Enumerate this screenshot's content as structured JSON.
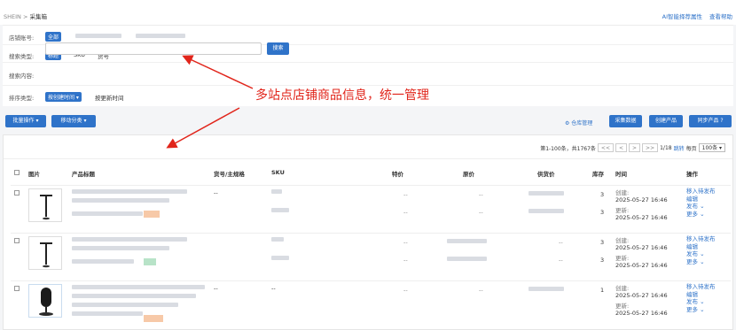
{
  "breadcrumb": {
    "root": "SHEIN",
    "sep": " > ",
    "current": "采集箱"
  },
  "top_links": {
    "ai": "AI智能择荐属性",
    "help": "查看帮助"
  },
  "filters": {
    "store_label": "店铺账号:",
    "store_all": "全部",
    "search_type_label": "搜索类型:",
    "search_types": [
      "标题",
      "SKU",
      "货号"
    ],
    "search_content_label": "搜索内容:",
    "search_button": "搜索",
    "sort_label": "排序类型:",
    "sort_selected": "按创建时间 ▾",
    "sort_alt": "按更新时间"
  },
  "toolbar": {
    "batch": "批量操作 ▾",
    "move": "移动分类 ▾",
    "warehouse": "⚙ 仓库管理",
    "collect": "采集数据",
    "create": "创建产品",
    "sync": "同步产品 ?"
  },
  "pager": {
    "summary": "第1-100条，共1767条",
    "first": "<<",
    "prev": "<",
    "next": ">",
    "last": ">>",
    "page": "1/18",
    "jump": "跳转",
    "per_page_label": "每页",
    "per_page": "100条 ▾"
  },
  "columns": [
    "图片",
    "产品标题",
    "货号/主规格",
    "SKU",
    "特价",
    "原价",
    "供货价",
    "库存",
    "时间",
    "操作"
  ],
  "rows": [
    {
      "dash1": "--",
      "special": [
        "--",
        "--"
      ],
      "orig": [
        "--",
        "--"
      ],
      "supply": [
        "",
        ""
      ],
      "stock": [
        "3",
        "3"
      ],
      "created_label": "创建:",
      "created": "2025-05-27 16:46",
      "updated_label": "更新:",
      "updated": "2025-05-27 16:46",
      "actions": [
        "移入待发布",
        "编辑",
        "发布 ⌄",
        "更多 ⌄"
      ],
      "tagcolor": "#f7c9a8"
    },
    {
      "dash1": "",
      "special": [
        "--",
        "--"
      ],
      "orig": [
        "",
        ""
      ],
      "supply": [
        "--",
        "--"
      ],
      "stock": [
        "3",
        "3"
      ],
      "created_label": "创建:",
      "created": "2025-05-27 16:46",
      "updated_label": "更新:",
      "updated": "2025-05-27 16:46",
      "actions": [
        "移入待发布",
        "编辑",
        "发布 ⌄",
        "更多 ⌄"
      ],
      "tagcolor": "#b8e3c8"
    },
    {
      "dash1": "--",
      "sku_dash": "--",
      "special": [
        "--",
        ""
      ],
      "orig": [
        "--",
        ""
      ],
      "supply": [
        "",
        ""
      ],
      "stock": [
        "1",
        ""
      ],
      "created_label": "创建:",
      "created": "2025-05-27 16:46",
      "updated_label": "更新:",
      "updated": "2025-05-27 16:46",
      "actions": [
        "移入待发布",
        "编辑",
        "发布 ⌄",
        "更多 ⌄"
      ],
      "tagcolor": "#f7c9a8"
    }
  ],
  "annotation": "多站点店铺商品信息，统一管理",
  "colors": {
    "accent": "#2f73c9",
    "annotation": "#e1251b"
  }
}
